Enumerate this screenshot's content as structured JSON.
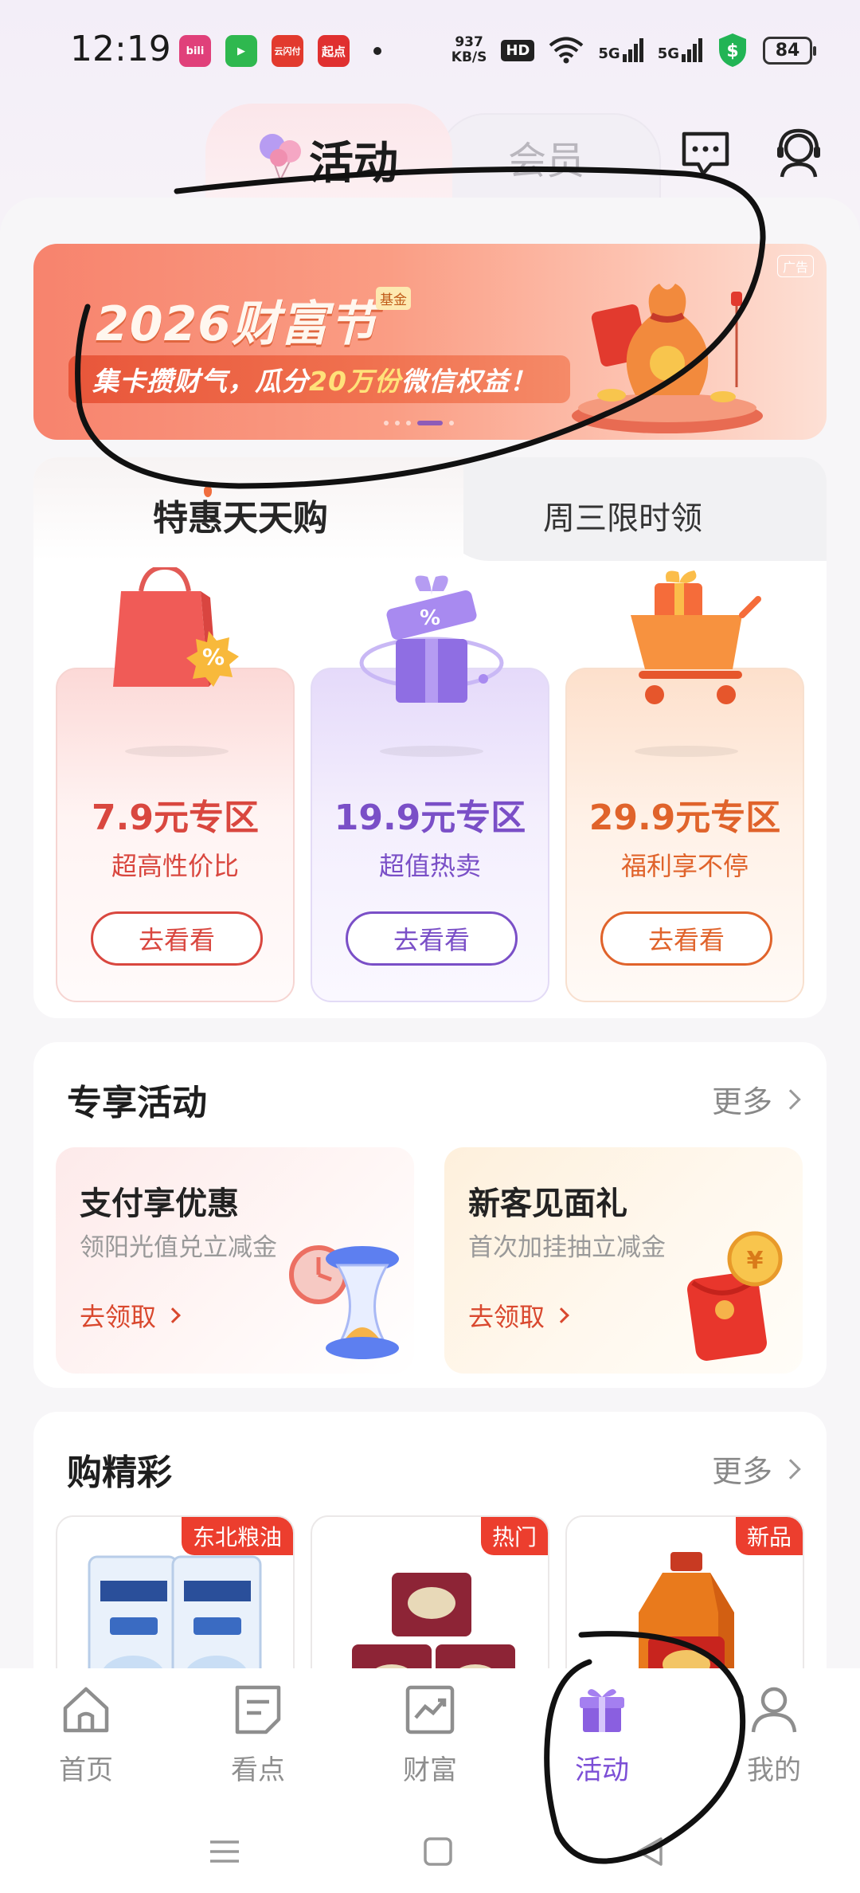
{
  "status_bar": {
    "time": "12:19",
    "apps": [
      {
        "icon": "bilibili-app-icon",
        "label": "bili",
        "color": "#e0407a"
      },
      {
        "icon": "video-app-icon",
        "label": "▶",
        "color": "#2fb84f"
      },
      {
        "icon": "cloud-pay-app-icon",
        "label": "云闪付",
        "color": "#e23a2e"
      },
      {
        "icon": "qidian-app-icon",
        "label": "起点",
        "color": "#e03030"
      }
    ],
    "speed_value": "937",
    "speed_unit": "KB/S",
    "hd_label": "HD",
    "net1": "5G",
    "net2": "5G",
    "battery": "84"
  },
  "top_tabs": {
    "activity": "活动",
    "member": "会员"
  },
  "banner": {
    "title": "2026财富节",
    "tag": "基金",
    "ad_label": "广告",
    "subtitle_pre": "集卡攒财气，瓜分",
    "subtitle_highlight": "20万份",
    "subtitle_post": "微信权益！"
  },
  "deals": {
    "tab_active": "特惠天天购",
    "tab_inactive": "周三限时领",
    "tiles": [
      {
        "price": "7.9元专区",
        "desc": "超高性价比",
        "button": "去看看"
      },
      {
        "price": "19.9元专区",
        "desc": "超值热卖",
        "button": "去看看"
      },
      {
        "price": "29.9元专区",
        "desc": "福利享不停",
        "button": "去看看"
      }
    ]
  },
  "exclusive": {
    "title": "专享活动",
    "more": "更多",
    "promos": [
      {
        "title": "支付享优惠",
        "subtitle": "领阳光值兑立减金",
        "action": "去领取"
      },
      {
        "title": "新客见面礼",
        "subtitle": "首次加挂抽立减金",
        "action": "去领取"
      }
    ]
  },
  "products": {
    "title": "购精彩",
    "more": "更多",
    "items": [
      {
        "tag": "东北粮油"
      },
      {
        "tag": "热门"
      },
      {
        "tag": "新品"
      }
    ]
  },
  "bottom_nav": [
    {
      "label": "首页",
      "icon": "home-icon"
    },
    {
      "label": "看点",
      "icon": "notes-icon"
    },
    {
      "label": "财富",
      "icon": "chart-icon"
    },
    {
      "label": "活动",
      "icon": "gift-icon",
      "active": true
    },
    {
      "label": "我的",
      "icon": "profile-icon"
    }
  ],
  "colors": {
    "accent_purple": "#7c4fd6",
    "deal_red": "#d9473f",
    "deal_purple": "#7a4fc7",
    "deal_orange": "#e0632b",
    "tag_red": "#ec3e2e"
  }
}
